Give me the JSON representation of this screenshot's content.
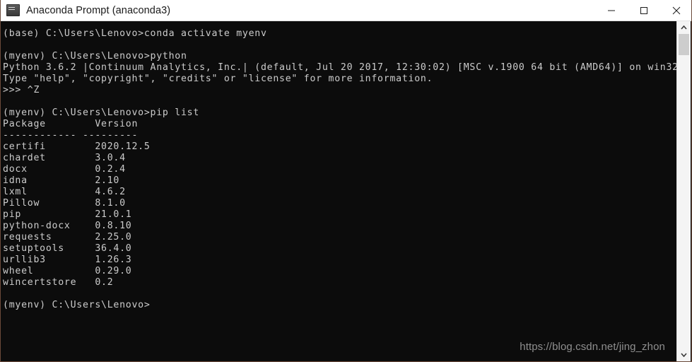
{
  "window": {
    "title": "Anaconda Prompt (anaconda3)",
    "icon": "console-window-icon",
    "background_color": "#0c0c0c",
    "titlebar_color": "#ffffff",
    "border_color": "#6b4a3a"
  },
  "window_controls": {
    "minimize_label": "Minimize",
    "maximize_label": "Maximize",
    "close_label": "Close"
  },
  "terminal": {
    "foreground_color": "#cccccc",
    "background_color": "#0c0c0c",
    "lines": [
      "(base) C:\\Users\\Lenovo>conda activate myenv",
      "",
      "(myenv) C:\\Users\\Lenovo>python",
      "Python 3.6.2 |Continuum Analytics, Inc.| (default, Jul 20 2017, 12:30:02) [MSC v.1900 64 bit (AMD64)] on win32",
      "Type \"help\", \"copyright\", \"credits\" or \"license\" for more information.",
      ">>> ^Z",
      "",
      "(myenv) C:\\Users\\Lenovo>pip list",
      "Package        Version",
      "------------ ---------",
      "certifi        2020.12.5",
      "chardet        3.0.4",
      "docx           0.2.4",
      "idna           2.10",
      "lxml           4.6.2",
      "Pillow         8.1.0",
      "pip            21.0.1",
      "python-docx    0.8.10",
      "requests       2.25.0",
      "setuptools     36.4.0",
      "urllib3        1.26.3",
      "wheel          0.29.0",
      "wincertstore   0.2",
      "",
      "(myenv) C:\\Users\\Lenovo>"
    ],
    "commands": [
      "conda activate myenv",
      "python",
      "pip list"
    ],
    "prompts": [
      "(base) C:\\Users\\Lenovo>",
      "(myenv) C:\\Users\\Lenovo>",
      "(myenv) C:\\Users\\Lenovo>",
      "(myenv) C:\\Users\\Lenovo>"
    ],
    "python_banner": {
      "version": "Python 3.6.2",
      "distribution": "|Continuum Analytics, Inc.|",
      "build": "(default, Jul 20 2017, 12:30:02)",
      "compiler": "[MSC v.1900 64 bit (AMD64)]",
      "platform": "on win32",
      "help_line": "Type \"help\", \"copyright\", \"credits\" or \"license\" for more information.",
      "repl_prompt": ">>> ^Z"
    },
    "pip_list": {
      "headers": [
        "Package",
        "Version"
      ],
      "separator": "------------ ---------",
      "rows": [
        {
          "package": "certifi",
          "version": "2020.12.5"
        },
        {
          "package": "chardet",
          "version": "3.0.4"
        },
        {
          "package": "docx",
          "version": "0.2.4"
        },
        {
          "package": "idna",
          "version": "2.10"
        },
        {
          "package": "lxml",
          "version": "4.6.2"
        },
        {
          "package": "Pillow",
          "version": "8.1.0"
        },
        {
          "package": "pip",
          "version": "21.0.1"
        },
        {
          "package": "python-docx",
          "version": "0.8.10"
        },
        {
          "package": "requests",
          "version": "2.25.0"
        },
        {
          "package": "setuptools",
          "version": "36.4.0"
        },
        {
          "package": "urllib3",
          "version": "1.26.3"
        },
        {
          "package": "wheel",
          "version": "0.29.0"
        },
        {
          "package": "wincertstore",
          "version": "0.2"
        }
      ]
    }
  },
  "watermark": {
    "text": "https://blog.csdn.net/jing_zhon",
    "color": "#8f8f8f"
  },
  "scrollbar": {
    "up_arrow": "chevron-up-icon",
    "down_arrow": "chevron-down-icon",
    "thumb_color": "#cdcdcd",
    "track_color": "#f4f4f4"
  }
}
